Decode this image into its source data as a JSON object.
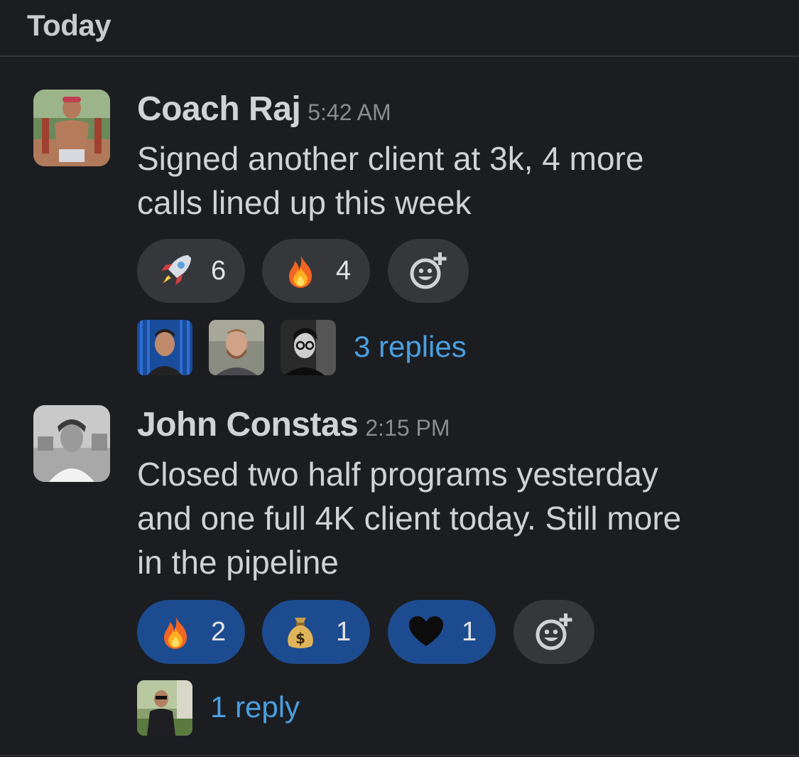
{
  "day_label": "Today",
  "messages": [
    {
      "author": "Coach Raj",
      "time": "5:42 AM",
      "lines": [
        "Signed another client at 3k, 4 more",
        "calls lined up this week"
      ],
      "reactions": [
        {
          "emoji": "rocket-emoji",
          "count": "6",
          "active": false
        },
        {
          "emoji": "fire-emoji",
          "count": "4",
          "active": false
        }
      ],
      "reply_text": "3 replies"
    },
    {
      "author": "John Constas",
      "time": "2:15 PM",
      "lines": [
        "Closed two half programs yesterday",
        "and one full 4K client today. Still more",
        "in the pipeline"
      ],
      "reactions": [
        {
          "emoji": "fire-emoji",
          "count": "2",
          "active": true
        },
        {
          "emoji": "money-bag-emoji",
          "count": "1",
          "active": true
        },
        {
          "emoji": "black-heart-emoji",
          "count": "1",
          "active": true
        }
      ],
      "reply_text": "1 reply"
    }
  ],
  "colors": {
    "background": "#1b1d21",
    "reaction_inactive": "#35373b",
    "reaction_active": "#1d4b8f",
    "link": "#4a9fe0"
  }
}
